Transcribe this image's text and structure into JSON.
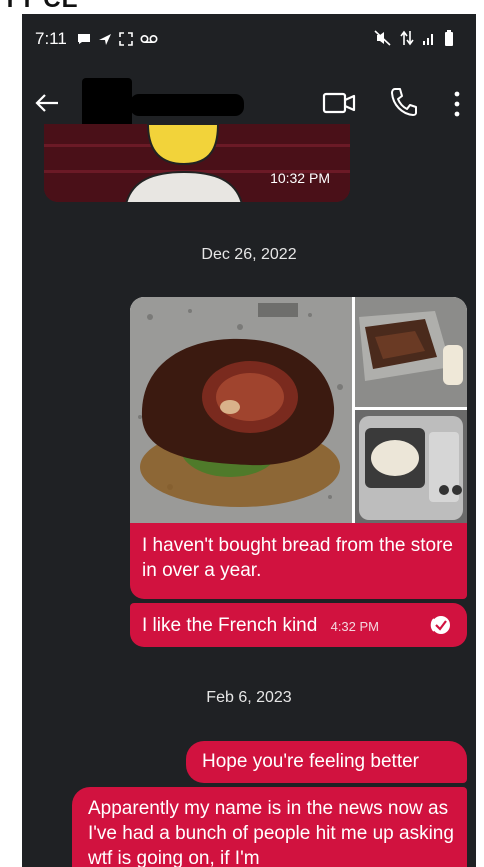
{
  "top_fragment": "YY CE",
  "status_bar": {
    "time": "7:11",
    "left_icons": [
      "chat-bubble-icon",
      "send-icon",
      "screen-capture-icon",
      "voicemail-icon"
    ],
    "right_icons": [
      "mute-icon",
      "data-arrows-icon",
      "signal-icon",
      "battery-icon"
    ]
  },
  "app_bar": {
    "back_icon": "arrow-left-icon",
    "contact_name": "",
    "actions": [
      "video-call-icon",
      "phone-icon",
      "more-vert-icon"
    ]
  },
  "messages": {
    "earlier_image_time": "10:32 PM",
    "date1": "Dec 26, 2022",
    "msg1": "I haven't bought bread from the store in over a year.",
    "msg2": "I like the French kind",
    "msg2_time": "4:32 PM",
    "date2": "Feb 6, 2023",
    "msg3": "Hope you're feeling better",
    "msg4": "Apparently my name is in the news now as I've had a bunch of people hit me up asking wtf is going on, if I'm"
  },
  "colors": {
    "background": "#1f2124",
    "bubble": "#d1123f",
    "text": "#ffffff"
  }
}
